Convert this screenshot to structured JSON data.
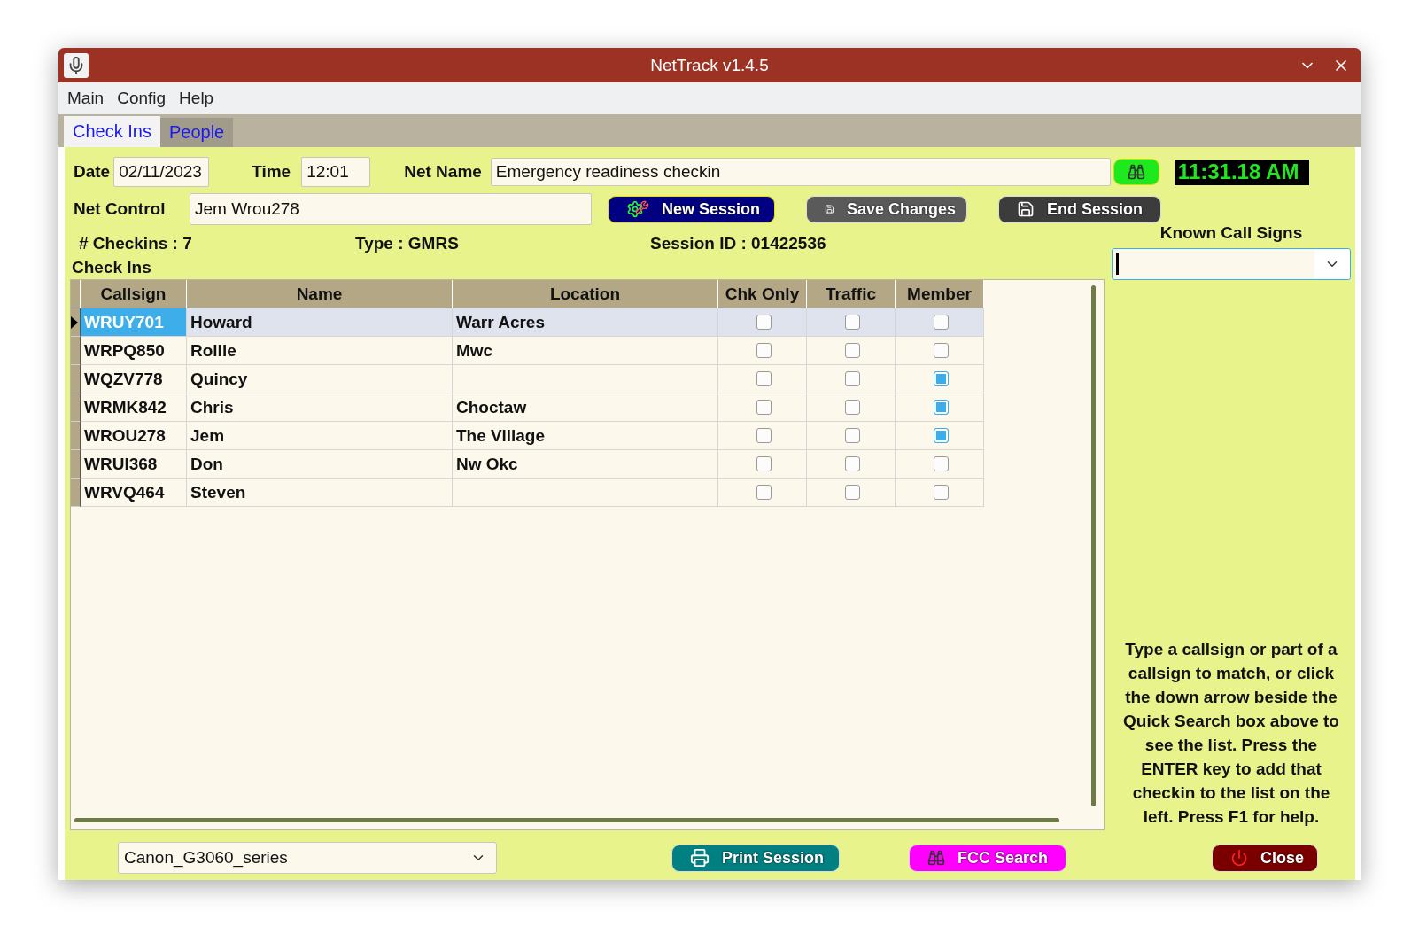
{
  "window": {
    "title": "NetTrack v1.4.5"
  },
  "menu": [
    "Main",
    "Config",
    "Help"
  ],
  "tabs": [
    {
      "label": "Check Ins",
      "selected": true
    },
    {
      "label": "People",
      "selected": false
    }
  ],
  "form": {
    "date_label": "Date",
    "date": "02/11/2023",
    "time_label": "Time",
    "time": "12:01",
    "net_name_label": "Net Name",
    "net_name": "Emergency readiness checkin",
    "clock": "11:31.18 AM",
    "net_control_label": "Net Control",
    "net_control": "Jem Wrou278"
  },
  "buttons": {
    "new_session": "New Session",
    "save_changes": "Save Changes",
    "end_session": "End Session",
    "print_session": "Print Session",
    "fcc_search": "FCC Search",
    "close": "Close"
  },
  "info": {
    "checkins_label": "# Checkins :",
    "checkins": "7",
    "type_label": "Type :",
    "type": "GMRS",
    "session_label": "Session ID :",
    "session": "01422536"
  },
  "group_title": "Check Ins",
  "table": {
    "columns": [
      "Callsign",
      "Name",
      "Location",
      "Chk Only",
      "Traffic",
      "Member"
    ],
    "rows": [
      {
        "callsign": "WRUY701",
        "name": "Howard",
        "location": "Warr Acres",
        "chk_only": false,
        "traffic": false,
        "member": false,
        "selected": true
      },
      {
        "callsign": "WRPQ850",
        "name": "Rollie",
        "location": "Mwc",
        "chk_only": false,
        "traffic": false,
        "member": false,
        "selected": false
      },
      {
        "callsign": "WQZV778",
        "name": "Quincy",
        "location": "",
        "chk_only": false,
        "traffic": false,
        "member": true,
        "selected": false
      },
      {
        "callsign": "WRMK842",
        "name": "Chris",
        "location": "Choctaw",
        "chk_only": false,
        "traffic": false,
        "member": true,
        "selected": false
      },
      {
        "callsign": "WROU278",
        "name": "Jem",
        "location": "The Village",
        "chk_only": false,
        "traffic": false,
        "member": true,
        "selected": false
      },
      {
        "callsign": "WRUI368",
        "name": "Don",
        "location": "Nw Okc",
        "chk_only": false,
        "traffic": false,
        "member": false,
        "selected": false
      },
      {
        "callsign": "WRVQ464",
        "name": "Steven",
        "location": "",
        "chk_only": false,
        "traffic": false,
        "member": false,
        "selected": false
      }
    ]
  },
  "known_call_signs": {
    "label": "Known Call Signs"
  },
  "help_text": "Type a callsign or part of a callsign to match, or click the down arrow beside the Quick Search box above to see the list. Press the ENTER key to add that checkin to the list on the left. Press F1 for help.",
  "printer": "Canon_G3060_series"
}
